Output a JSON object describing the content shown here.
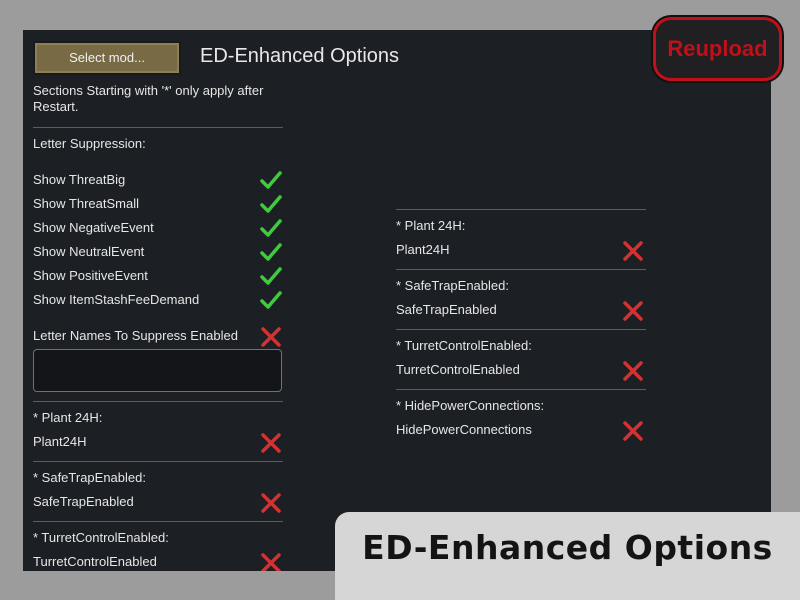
{
  "window": {
    "select_mod_label": "Select mod...",
    "title": "ED-Enhanced Options",
    "restart_note": "Sections Starting with '*' only apply after Restart."
  },
  "left_column": {
    "letter_suppression_header": "Letter Suppression:",
    "checkbox_items": [
      {
        "label": "Show ThreatBig",
        "checked": true
      },
      {
        "label": "Show ThreatSmall",
        "checked": true
      },
      {
        "label": "Show NegativeEvent",
        "checked": true
      },
      {
        "label": "Show NeutralEvent",
        "checked": true
      },
      {
        "label": "Show PositiveEvent",
        "checked": true
      },
      {
        "label": "Show ItemStashFeeDemand",
        "checked": true
      }
    ],
    "letter_names_enabled": {
      "label": "Letter Names To Suppress Enabled",
      "checked": false
    },
    "letter_names_value": "",
    "sections": [
      {
        "header": "* Plant 24H:",
        "label": "Plant24H",
        "checked": false
      },
      {
        "header": "* SafeTrapEnabled:",
        "label": "SafeTrapEnabled",
        "checked": false
      },
      {
        "header": "* TurretControlEnabled:",
        "label": "TurretControlEnabled",
        "checked": false
      }
    ]
  },
  "right_column": {
    "sections": [
      {
        "header": "* Plant 24H:",
        "label": "Plant24H",
        "checked": false
      },
      {
        "header": "* SafeTrapEnabled:",
        "label": "SafeTrapEnabled",
        "checked": false
      },
      {
        "header": "* TurretControlEnabled:",
        "label": "TurretControlEnabled",
        "checked": false
      },
      {
        "header": "* HidePowerConnections:",
        "label": "HidePowerConnections",
        "checked": false
      }
    ]
  },
  "overlay": {
    "reupload_badge": "Reupload",
    "banner_title": "ED-Enhanced Options"
  },
  "colors": {
    "check": "#3ccc3c",
    "cross": "#d23232",
    "button": "#776a45",
    "panel": "#1c1f24"
  },
  "icons": {
    "checked": "checkmark-icon",
    "unchecked": "cross-icon"
  }
}
